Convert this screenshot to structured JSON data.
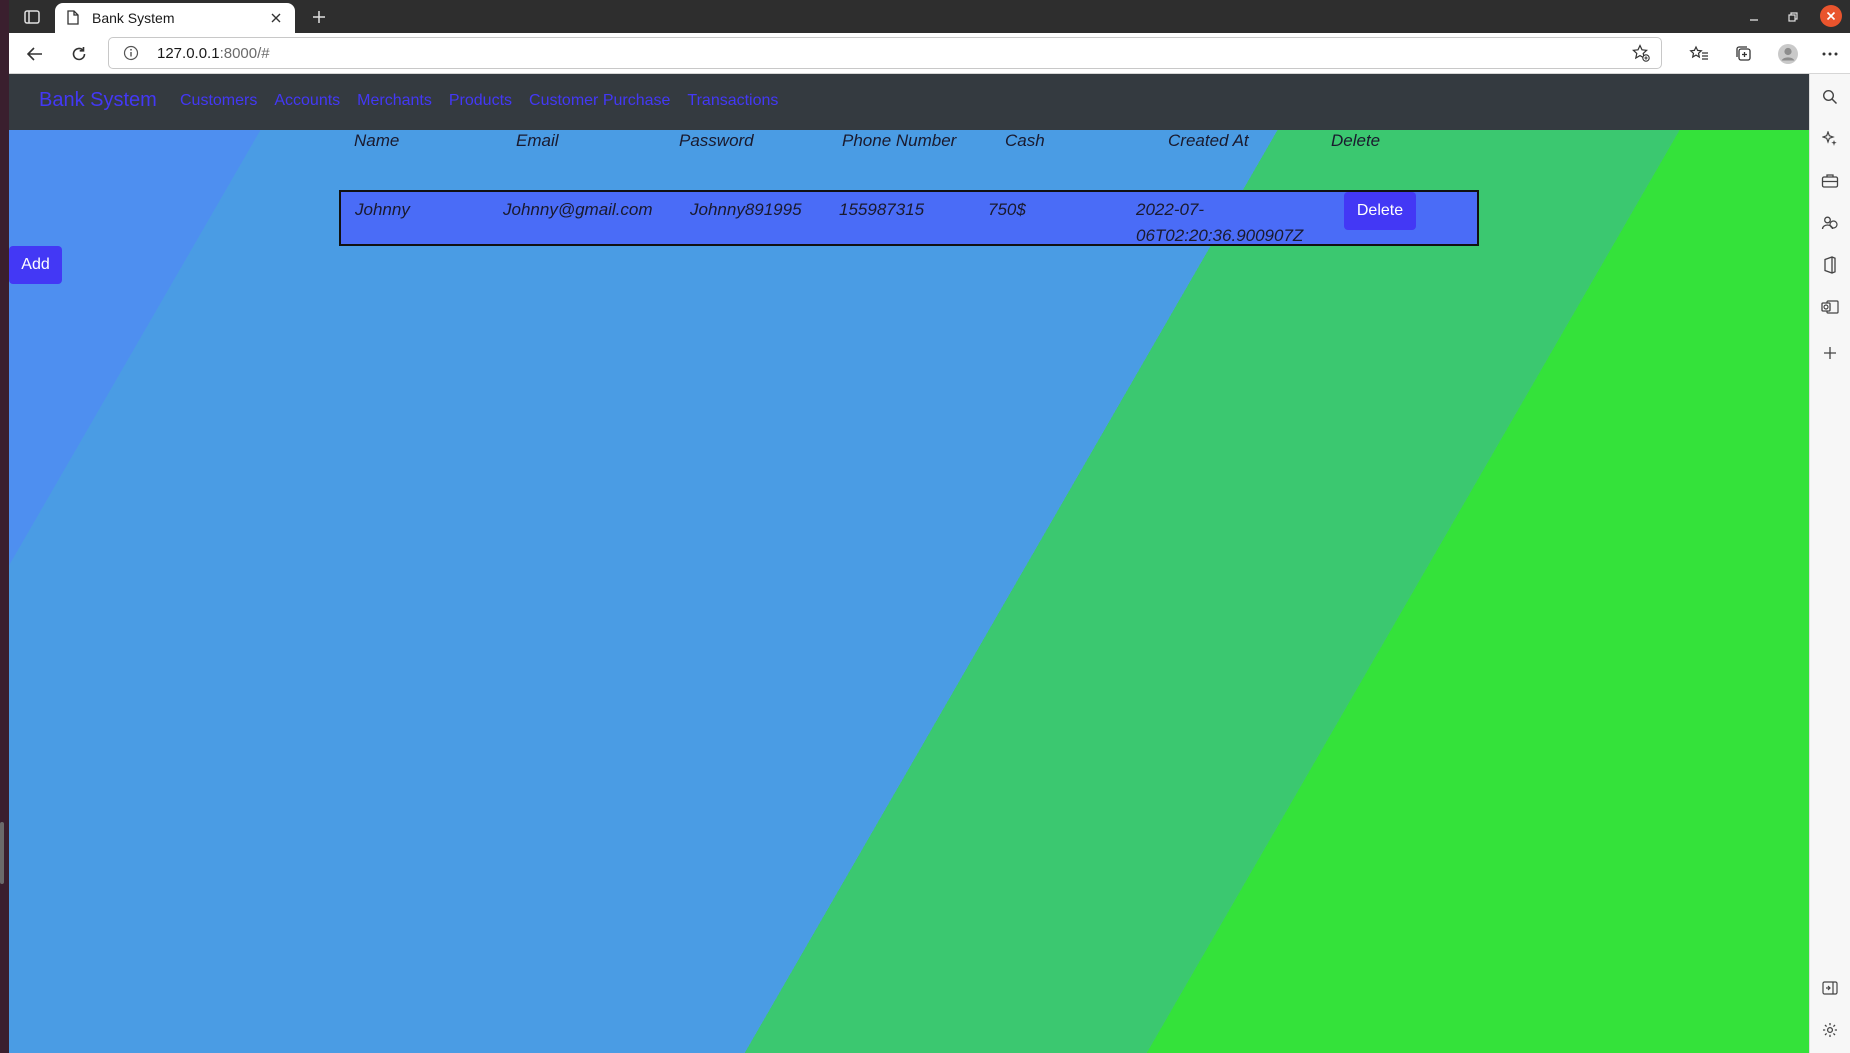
{
  "browser": {
    "tab_title": "Bank System",
    "url_host": "127.0.0.1",
    "url_rest": ":8000/#"
  },
  "navbar": {
    "brand": "Bank System",
    "links": [
      "Customers",
      "Accounts",
      "Merchants",
      "Products",
      "Customer Purchase",
      "Transactions"
    ]
  },
  "table": {
    "headers": [
      "Name",
      "Email",
      "Password",
      "Phone Number",
      "Cash",
      "Created At",
      "Delete"
    ],
    "rows": [
      {
        "name": "Johnny",
        "email": "Johnny@gmail.com",
        "password": "Johnny891995",
        "phone": "155987315",
        "cash": "750$",
        "created_line1": "2022-07-",
        "created_line2": "06T02:20:36.900907Z",
        "delete_label": "Delete"
      }
    ]
  },
  "add_label": "Add",
  "colors": {
    "accent": "#4338f5",
    "navbar_bg": "#343a40",
    "row_bg": "#4a6cf7",
    "bg_blue": "#4a9ce4",
    "bg_teal": "#3bc870",
    "bg_green": "#34e23a"
  }
}
